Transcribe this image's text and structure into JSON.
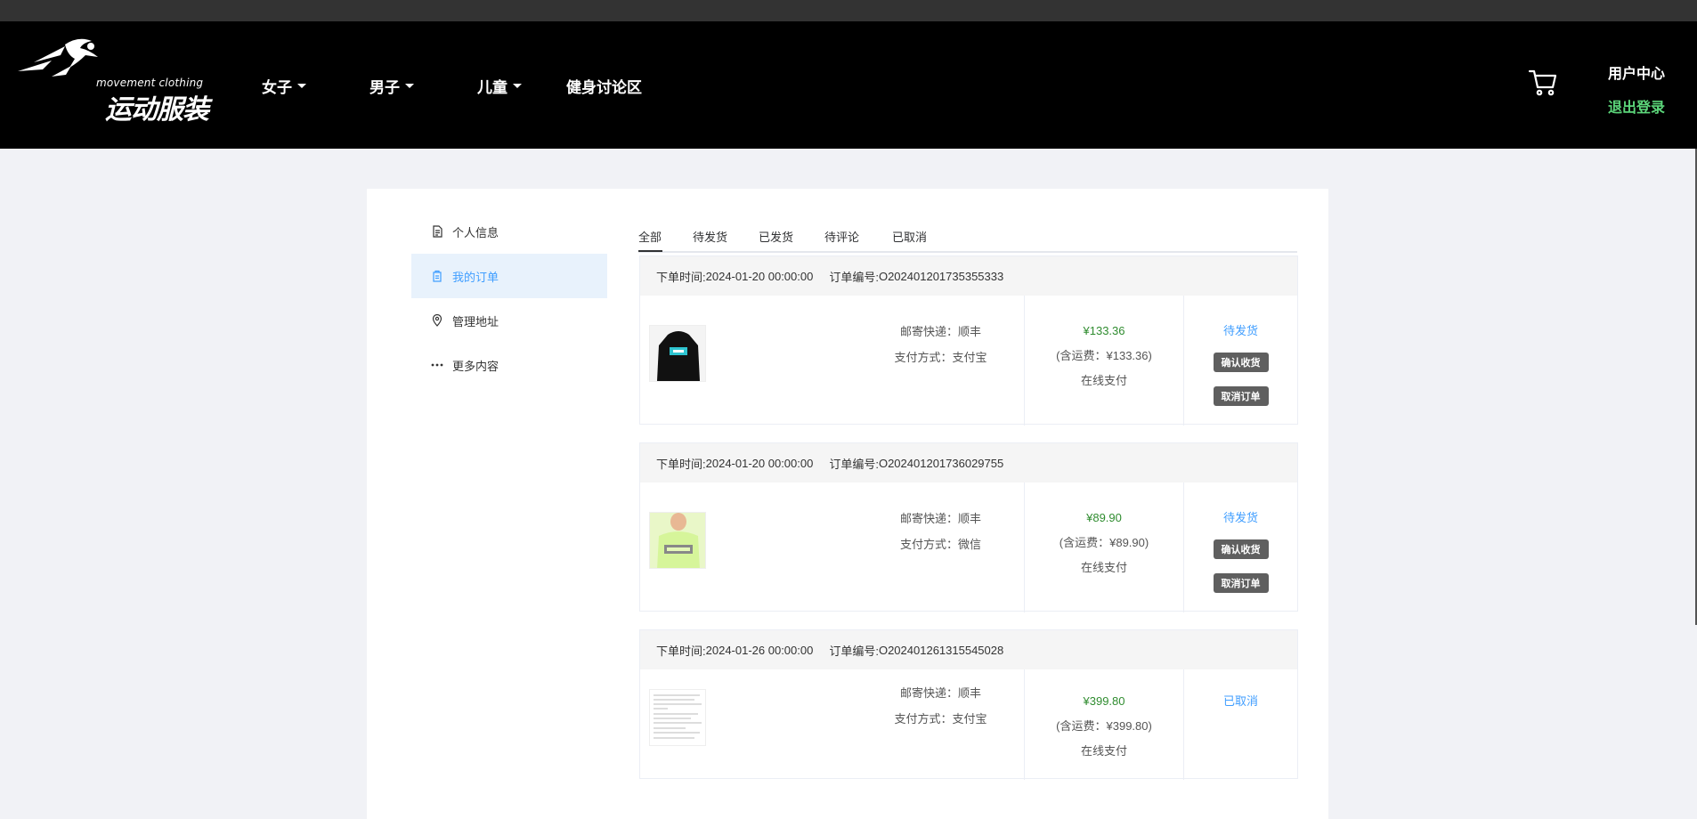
{
  "header": {
    "logo_en": "movement clothing",
    "logo_cn": "运动服装",
    "nav": [
      {
        "label": "女子",
        "dropdown": true
      },
      {
        "label": "男子",
        "dropdown": true
      },
      {
        "label": "儿童",
        "dropdown": true
      },
      {
        "label": "健身讨论区",
        "dropdown": false
      }
    ],
    "cart_icon": "cart-icon",
    "user_center": "用户中心",
    "logout": "退出登录"
  },
  "sidebar": {
    "items": [
      {
        "label": "个人信息",
        "icon": "document-icon",
        "active": false
      },
      {
        "label": "我的订单",
        "icon": "order-icon",
        "active": true
      },
      {
        "label": "管理地址",
        "icon": "location-pin-icon",
        "active": false
      },
      {
        "label": "更多内容",
        "icon": "more-dots-icon",
        "active": false
      }
    ]
  },
  "tabs": [
    "全部",
    "待发货",
    "已发货",
    "待评论",
    "已取消"
  ],
  "active_tab": "全部",
  "orders": [
    {
      "time_label": "下单时间:",
      "time": "2024-01-20 00:00:00",
      "no_label": "订单编号:",
      "no": "O202401201735355333",
      "shipping": "邮寄快递：顺丰",
      "payment": "支付方式：支付宝",
      "price": "¥133.36",
      "freight": "(含运费：¥133.36)",
      "pay_type": "在线支付",
      "status": "待发货",
      "buttons": [
        "确认收货",
        "取消订单"
      ],
      "thumb_desc": "black hoodie"
    },
    {
      "time_label": "下单时间:",
      "time": "2024-01-20 00:00:00",
      "no_label": "订单编号:",
      "no": "O202401201736029755",
      "shipping": "邮寄快递：顺丰",
      "payment": "支付方式：微信",
      "price": "¥89.90",
      "freight": "(含运费：¥89.90)",
      "pay_type": "在线支付",
      "status": "待发货",
      "buttons": [
        "确认收货",
        "取消订单"
      ],
      "thumb_desc": "lime hoodie"
    },
    {
      "time_label": "下单时间:",
      "time": "2024-01-26 00:00:00",
      "no_label": "订单编号:",
      "no": "O202401261315545028",
      "shipping": "邮寄快递：顺丰",
      "payment": "支付方式：支付宝",
      "price": "¥399.80",
      "freight": "(含运费：¥399.80)",
      "pay_type": "在线支付",
      "status": "已取消",
      "buttons": [],
      "thumb_desc": "text document"
    }
  ],
  "colors": {
    "header_bg": "#000000",
    "page_bg": "#f1f2f6",
    "accent_blue": "#409eff",
    "price_green": "#2f8c2f",
    "logout_green": "#5cd67a",
    "button_gray": "#5f5f5f"
  }
}
